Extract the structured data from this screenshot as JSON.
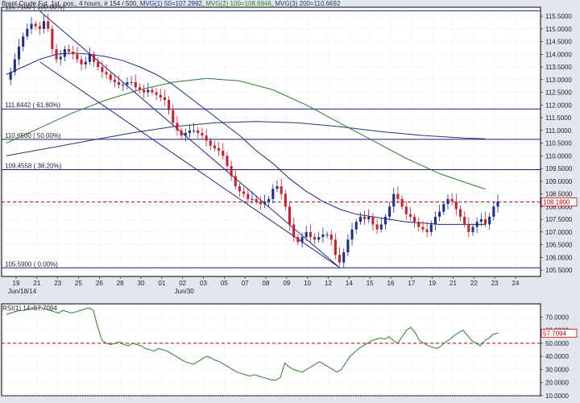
{
  "header": {
    "instrument": "Brent Crude Fut. 1st. pos.",
    "timeframe": "4 hours",
    "bars": "# 154 / 500",
    "mvg1": "MVG(1) 50=107.2992",
    "mvg2": "MVG(2) 100=108.6946",
    "mvg3": "MVG(3) 200=110.6692"
  },
  "colors": {
    "background": "#e3e6ee",
    "plot_bg": "#ffffff",
    "grid": "#d0d0d8",
    "frame": "#000000",
    "bull_candle": "#1c2f8e",
    "bear_candle": "#c8202e",
    "mvg50": "#1a2a8a",
    "mvg100": "#2e7d2e",
    "mvg200": "#1f3a6e",
    "fib_line": "#1a1a7a",
    "current_price": "#c00000",
    "rsi_line": "#2e7d2e",
    "rsi_mid": "#c00000"
  },
  "chart_data": [
    {
      "type": "candlestick",
      "title": "Brent Crude Fut. 1st. pos., 4 hours",
      "ylim": [
        105.25,
        115.85
      ],
      "y_ticks": [
        "115.5000",
        "115.0000",
        "114.5000",
        "114.0000",
        "113.5000",
        "113.0000",
        "112.5000",
        "112.0000",
        "111.5000",
        "111.0000",
        "110.5000",
        "110.0000",
        "109.5000",
        "109.0000",
        "108.5000",
        "108.0000",
        "107.5000",
        "107.0000",
        "106.5000",
        "106.0000",
        "105.5000"
      ],
      "x_ticks": [
        "19",
        "21",
        "23",
        "25",
        "26",
        "28",
        "30",
        "01",
        "02",
        "03",
        "05",
        "07",
        "08",
        "09",
        "10",
        "12",
        "14",
        "15",
        "16",
        "17",
        "19",
        "21",
        "22",
        "23",
        "24"
      ],
      "x_sublabels": [
        "Jun/18/14",
        "Jun/30"
      ],
      "current_price": "108.1800",
      "current_price_value": 108.18,
      "fib_levels": [
        {
          "label": "115.7100 ( 100.00%)",
          "value": 115.71
        },
        {
          "label": "111.8442 ( 61.80%)",
          "value": 111.8442
        },
        {
          "label": "110.6500 ( 50.00%)",
          "value": 110.65
        },
        {
          "label": "109.4558 ( 38.20%)",
          "value": 109.4558
        },
        {
          "label": "105.5900 ( 0.00%)",
          "value": 105.59
        }
      ],
      "price_path": [
        113.0,
        113.3,
        113.8,
        114.3,
        114.7,
        115.0,
        115.2,
        115.1,
        115.0,
        115.3,
        115.0,
        114.2,
        113.8,
        113.9,
        114.2,
        114.1,
        114.0,
        113.8,
        113.6,
        113.7,
        114.0,
        113.7,
        113.5,
        113.3,
        113.2,
        113.0,
        112.9,
        112.8,
        112.8,
        112.9,
        112.9,
        112.7,
        112.6,
        112.5,
        112.6,
        112.5,
        112.4,
        112.3,
        112.2,
        111.8,
        111.3,
        111.0,
        110.8,
        110.9,
        111.0,
        111.0,
        110.9,
        110.8,
        110.6,
        110.4,
        110.3,
        110.2,
        110.0,
        109.6,
        109.2,
        108.8,
        108.6,
        108.5,
        108.3,
        108.3,
        108.2,
        108.1,
        108.2,
        108.3,
        108.7,
        108.8,
        108.5,
        108.0,
        107.3,
        106.8,
        106.6,
        106.8,
        107.0,
        106.8,
        106.7,
        106.8,
        106.9,
        106.9,
        106.7,
        106.1,
        105.8,
        106.2,
        106.7,
        107.1,
        107.4,
        107.6,
        107.5,
        107.6,
        107.3,
        107.1,
        107.3,
        107.6,
        108.0,
        108.5,
        108.3,
        108.0,
        107.7,
        107.6,
        107.4,
        107.2,
        107.1,
        107.0,
        107.3,
        107.6,
        107.8,
        108.1,
        108.3,
        108.2,
        107.9,
        107.6,
        107.3,
        107.0,
        107.2,
        107.4,
        107.5,
        107.3,
        107.6,
        108.0,
        108.2
      ],
      "mvg50": [
        [
          0,
          113.2
        ],
        [
          4,
          113.5
        ],
        [
          8,
          113.8
        ],
        [
          12,
          114.0
        ],
        [
          16,
          114.05
        ],
        [
          20,
          114.0
        ],
        [
          24,
          113.9
        ],
        [
          28,
          113.75
        ],
        [
          32,
          113.5
        ],
        [
          36,
          113.2
        ],
        [
          40,
          112.8
        ],
        [
          44,
          112.3
        ],
        [
          48,
          111.8
        ],
        [
          52,
          111.3
        ],
        [
          56,
          110.8
        ],
        [
          60,
          110.2
        ],
        [
          64,
          109.7
        ],
        [
          68,
          109.1
        ],
        [
          72,
          108.6
        ],
        [
          76,
          108.2
        ],
        [
          80,
          107.9
        ],
        [
          84,
          107.7
        ],
        [
          88,
          107.6
        ],
        [
          92,
          107.5
        ],
        [
          96,
          107.4
        ],
        [
          100,
          107.35
        ],
        [
          104,
          107.3
        ],
        [
          108,
          107.3
        ],
        [
          112,
          107.3
        ],
        [
          115,
          107.3
        ]
      ],
      "mvg100": [
        [
          0,
          110.5
        ],
        [
          8,
          111.1
        ],
        [
          16,
          111.7
        ],
        [
          24,
          112.2
        ],
        [
          32,
          112.6
        ],
        [
          40,
          112.9
        ],
        [
          48,
          113.05
        ],
        [
          56,
          112.95
        ],
        [
          64,
          112.6
        ],
        [
          72,
          112.0
        ],
        [
          80,
          111.3
        ],
        [
          88,
          110.6
        ],
        [
          96,
          109.9
        ],
        [
          104,
          109.3
        ],
        [
          112,
          108.85
        ],
        [
          115,
          108.69
        ]
      ],
      "mvg200": [
        [
          0,
          110.0
        ],
        [
          10,
          110.3
        ],
        [
          20,
          110.6
        ],
        [
          30,
          110.9
        ],
        [
          40,
          111.15
        ],
        [
          50,
          111.3
        ],
        [
          60,
          111.35
        ],
        [
          70,
          111.3
        ],
        [
          80,
          111.15
        ],
        [
          90,
          110.95
        ],
        [
          100,
          110.8
        ],
        [
          110,
          110.7
        ],
        [
          115,
          110.67
        ]
      ],
      "channel_lines": [
        [
          [
            8,
            115.7
          ],
          [
            80,
            105.6
          ]
        ],
        [
          [
            8,
            113.7
          ],
          [
            80,
            105.6
          ]
        ]
      ]
    },
    {
      "type": "line",
      "title": "RSI(1) 14=57.7094",
      "ylim": [
        10,
        80
      ],
      "y_ticks": [
        "70.0000",
        "60.0000",
        "50.0000",
        "40.0000",
        "30.0000",
        "20.0000",
        "10.0000"
      ],
      "current_value": "57.7094",
      "current_value_num": 57.7094,
      "midline": 50,
      "rsi": [
        72,
        73,
        74,
        75,
        75,
        76,
        76,
        77,
        77,
        76,
        75,
        74,
        73,
        75,
        74,
        73,
        74,
        75,
        76,
        77,
        75,
        62,
        52,
        50,
        49,
        50,
        51,
        49,
        48,
        50,
        49,
        48,
        46,
        45,
        44,
        46,
        45,
        44,
        42,
        40,
        38,
        36,
        35,
        34,
        36,
        38,
        40,
        39,
        37,
        36,
        34,
        32,
        30,
        28,
        27,
        26,
        25,
        26,
        25,
        24,
        23,
        22,
        22,
        24,
        35,
        32,
        30,
        29,
        28,
        30,
        32,
        34,
        36,
        34,
        32,
        30,
        28,
        30,
        35,
        40,
        43,
        46,
        48,
        50,
        52,
        53,
        54,
        53,
        55,
        52,
        50,
        55,
        60,
        62,
        58,
        52,
        50,
        48,
        47,
        46,
        48,
        51,
        53,
        56,
        58,
        60,
        56,
        52,
        50,
        48,
        52,
        54,
        57,
        57.7
      ]
    }
  ]
}
